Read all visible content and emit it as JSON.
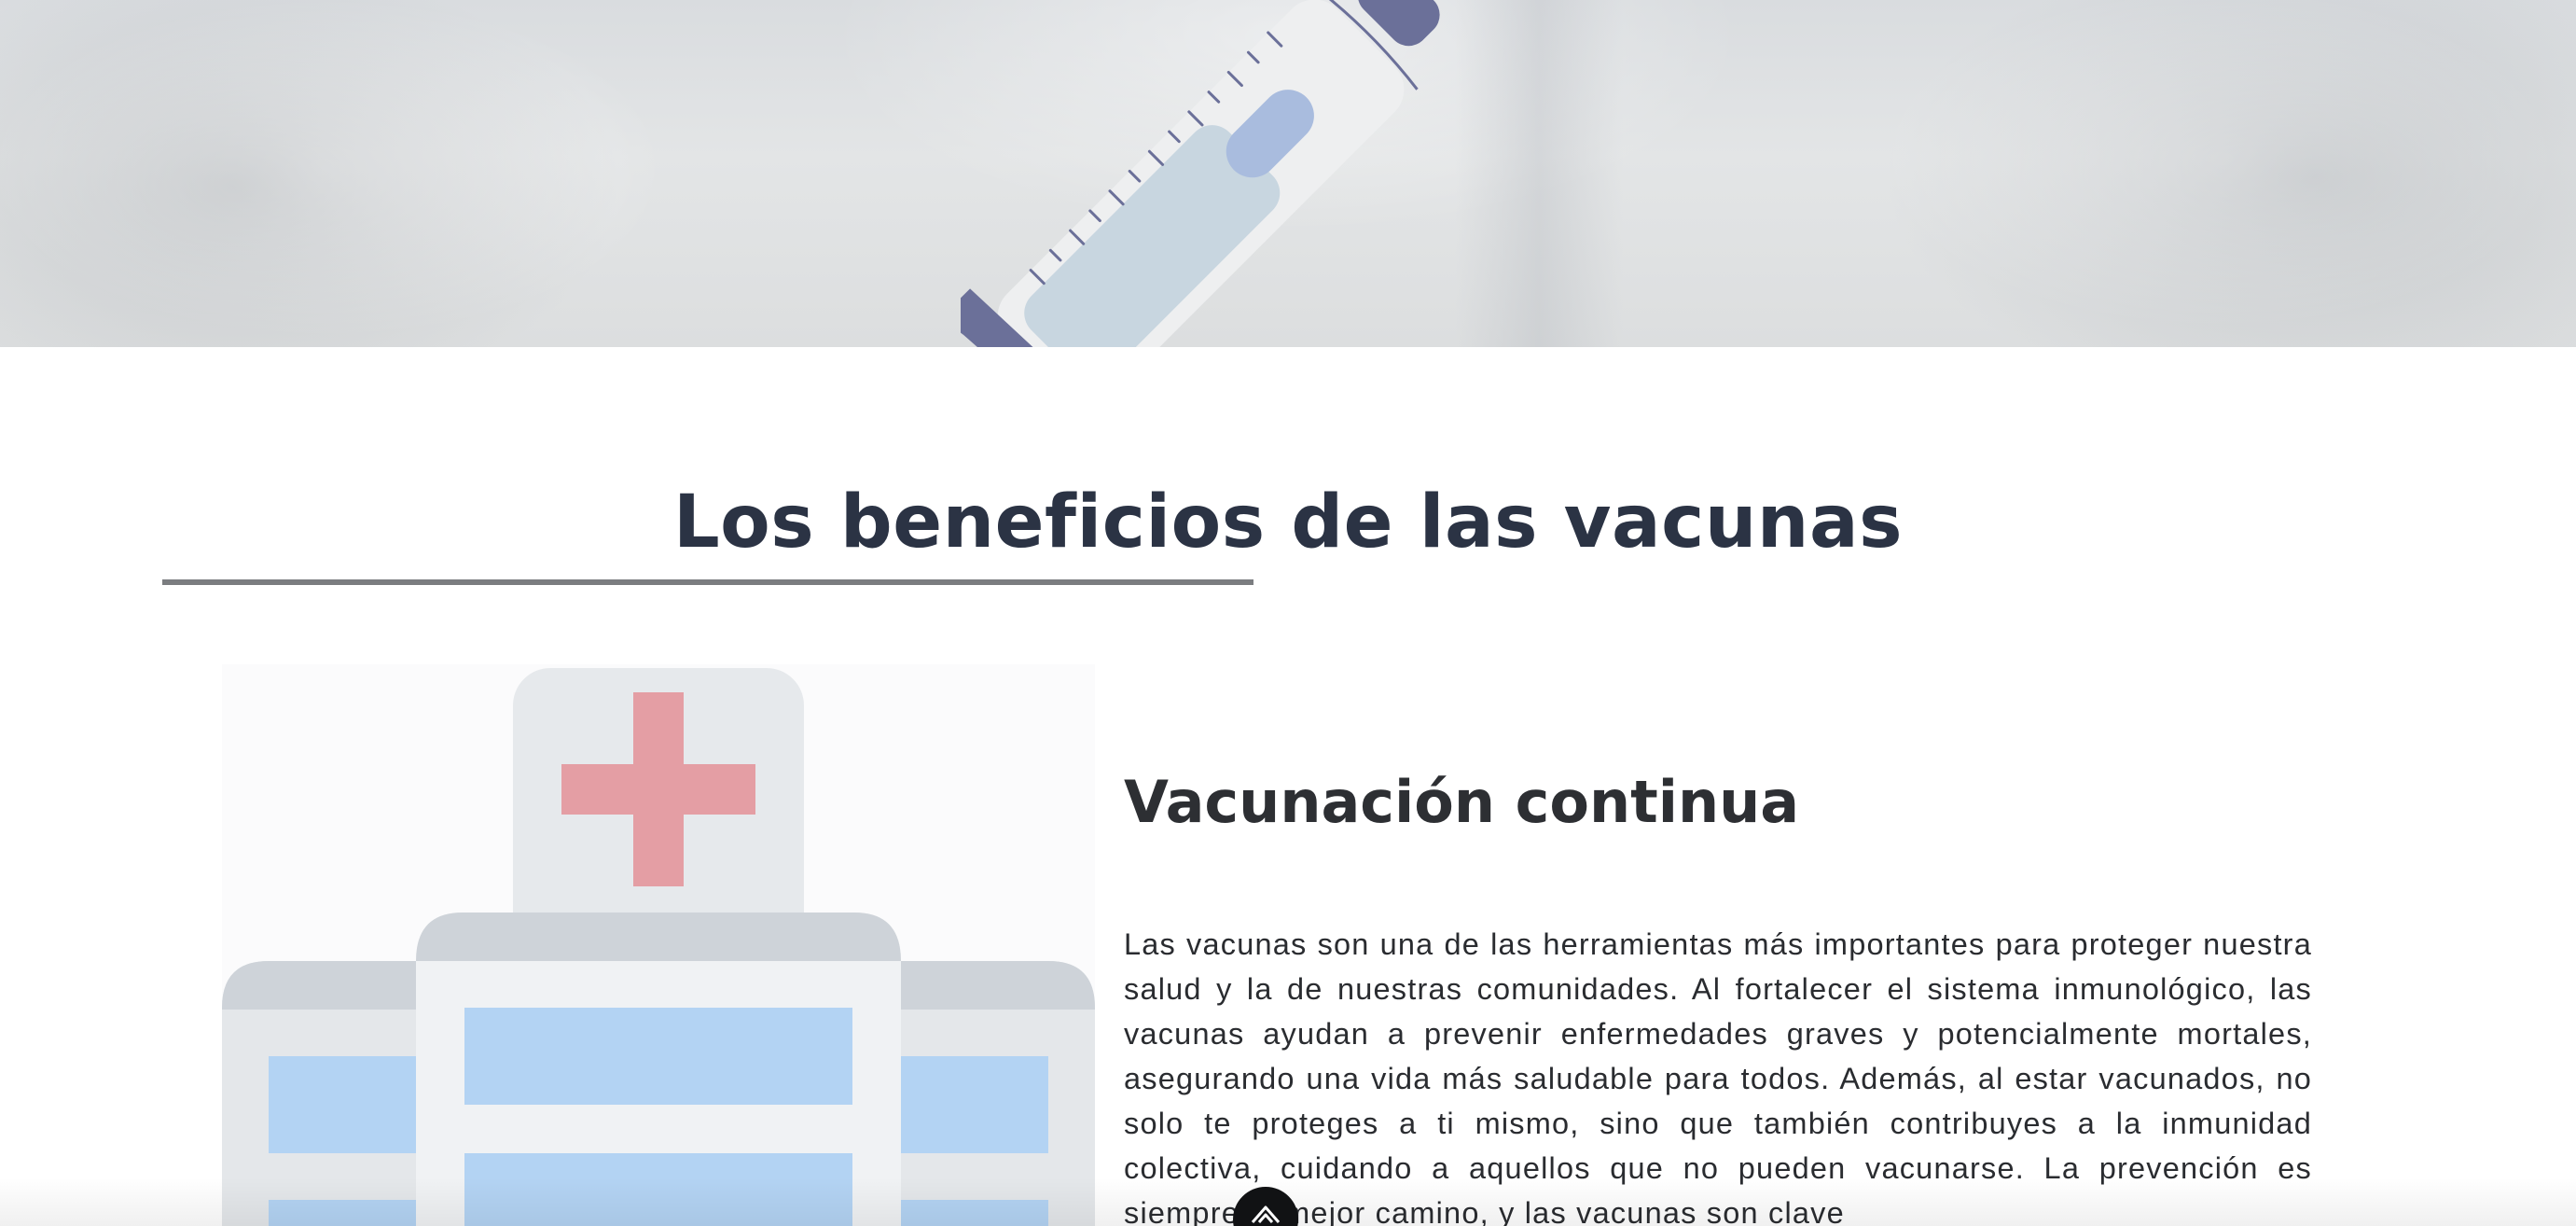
{
  "hero": {
    "image": "syringe-illustration"
  },
  "section": {
    "title": "Los beneficios de las vacunas"
  },
  "feature": {
    "illustration": "hospital-illustration",
    "heading": "Vacunación continua",
    "body": "Las vacunas son una de las herramientas más importantes para proteger nuestra salud y la de nuestras comunidades. Al fortalecer el sistema inmunológico, las vacunas ayudan a prevenir enfermedades graves y potencialmente mortales, asegurando una vida más saludable para todos. Además, al estar vacunados, no solo te proteges a ti mismo, sino que también contribuyes a la inmunidad colectiva, cuidando a aquellos que no pueden vacunarse. La prevención es siempre el mejor camino, y las vacunas son clave"
  },
  "floating_button": {
    "icon": "chevron-up-icon"
  },
  "colors": {
    "title": "#2b3344",
    "underline": "#7b7d80",
    "cross": "#e49ea4",
    "window_blue": "#b3d3f3",
    "syringe_blue": "#6b7099"
  }
}
